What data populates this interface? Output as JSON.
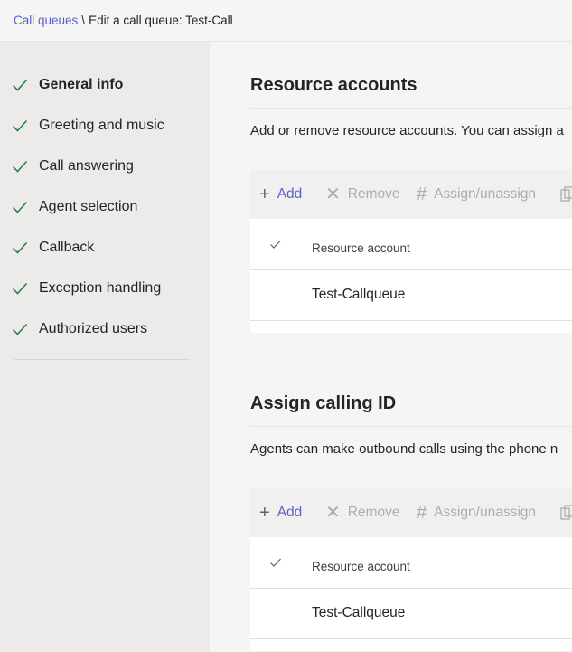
{
  "breadcrumb": {
    "parent": "Call queues",
    "separator": "\\",
    "current": "Edit a call queue: Test-Call"
  },
  "sidebar": {
    "items": [
      {
        "label": "General info",
        "active": true,
        "icon": "checkmark-icon"
      },
      {
        "label": "Greeting and music",
        "active": false,
        "icon": "checkmark-icon"
      },
      {
        "label": "Call answering",
        "active": false,
        "icon": "checkmark-icon"
      },
      {
        "label": "Agent selection",
        "active": false,
        "icon": "checkmark-icon"
      },
      {
        "label": "Callback",
        "active": false,
        "icon": "checkmark-icon"
      },
      {
        "label": "Exception handling",
        "active": false,
        "icon": "checkmark-icon"
      },
      {
        "label": "Authorized users",
        "active": false,
        "icon": "checkmark-icon"
      }
    ]
  },
  "resource_accounts": {
    "title": "Resource accounts",
    "description": "Add or remove resource accounts. You can assign a",
    "toolbar": {
      "add_label": "Add",
      "remove_label": "Remove",
      "assign_label": "Assign/unassign"
    },
    "table": {
      "column_header": "Resource account",
      "rows": [
        "Test-Callqueue"
      ]
    }
  },
  "calling_id": {
    "title": "Assign calling ID",
    "description": "Agents can make outbound calls using the phone n",
    "toolbar": {
      "add_label": "Add",
      "remove_label": "Remove",
      "assign_label": "Assign/unassign"
    },
    "table": {
      "column_header": "Resource account",
      "rows": [
        "Test-Callqueue"
      ]
    }
  },
  "colors": {
    "accent": "#5b5fc7",
    "check": "#237b4b",
    "disabled": "#adadad"
  }
}
